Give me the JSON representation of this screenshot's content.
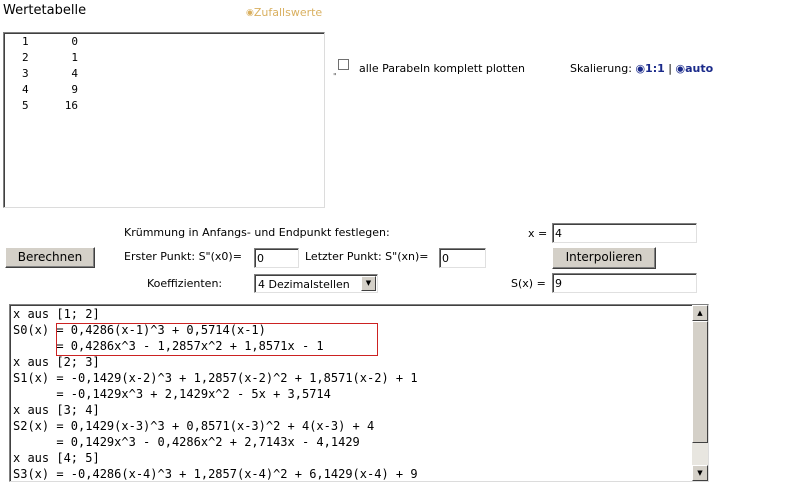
{
  "title": "Wertetabelle",
  "random_option": {
    "glyph": "◉",
    "label": "Zufallswerte"
  },
  "table": {
    "rows": [
      {
        "x": "1",
        "y": "0"
      },
      {
        "x": "2",
        "y": "1"
      },
      {
        "x": "3",
        "y": "4"
      },
      {
        "x": "4",
        "y": "9"
      },
      {
        "x": "5",
        "y": "16"
      }
    ]
  },
  "plot_all": {
    "label": "alle Parabeln komplett plotten",
    "checked": false,
    "mark": "\""
  },
  "scaling": {
    "label": "Skalierung:",
    "option1": "◉1:1",
    "separator": "|",
    "option2": "◉auto"
  },
  "curvature": {
    "label": "Krümmung in Anfangs- und Endpunkt festlegen:"
  },
  "first_point": {
    "label": "Erster Punkt: S\"(x0)=",
    "value": "0"
  },
  "last_point": {
    "label": "Letzter Punkt: S\"(xn)=",
    "value": "0"
  },
  "coefficients": {
    "label": "Koeffizienten:",
    "selected": "4 Dezimalstellen",
    "arrow": "▼"
  },
  "calculate_button": "Berechnen",
  "x_input": {
    "label": "x =",
    "value": "4"
  },
  "interpolate_button": "Interpolieren",
  "sx_output": {
    "label": "S(x) =",
    "value": "9"
  },
  "output_lines": [
    "x aus [1; 2]",
    "S0(x) = 0,4286(x-1)^3 + 0,5714(x-1)",
    "      = 0,4286x^3 - 1,2857x^2 + 1,8571x - 1",
    "x aus [2; 3]",
    "S1(x) = -0,1429(x-2)^3 + 1,2857(x-2)^2 + 1,8571(x-2) + 1",
    "      = -0,1429x^3 + 2,1429x^2 - 5x + 3,5714",
    "x aus [3; 4]",
    "S2(x) = 0,1429(x-3)^3 + 0,8571(x-3)^2 + 4(x-3) + 4",
    "      = 0,1429x^3 - 0,4286x^2 + 2,7143x - 4,1429",
    "x aus [4; 5]",
    "S3(x) = -0,4286(x-4)^3 + 1,2857(x-4)^2 + 6,1429(x-4) + 9"
  ],
  "scrollbar": {
    "up": "▲",
    "down": "▼"
  }
}
